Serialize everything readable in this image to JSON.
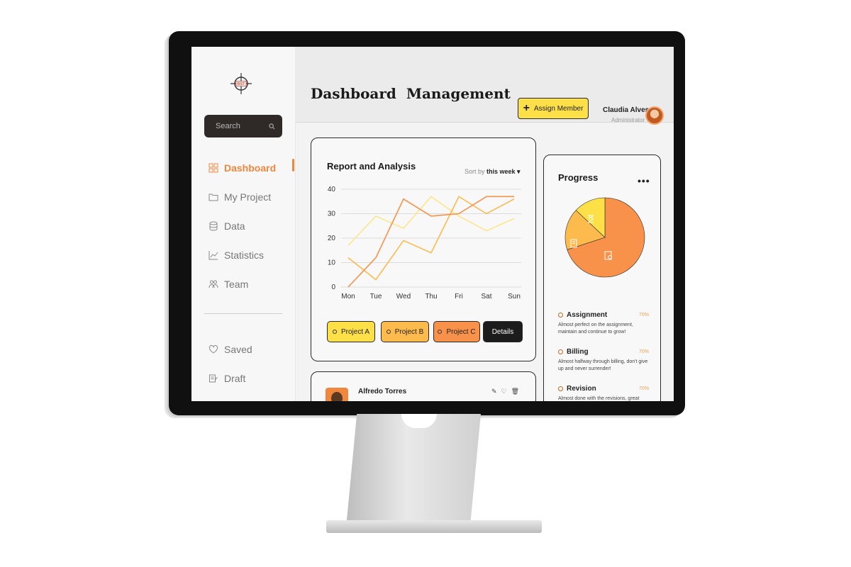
{
  "sidebar": {
    "logo_text": "RST",
    "search_placeholder": "Search",
    "items": [
      {
        "label": "Dashboard",
        "icon": "grid-icon",
        "active": true
      },
      {
        "label": "My Project",
        "icon": "folder-icon"
      },
      {
        "label": "Data",
        "icon": "database-icon"
      },
      {
        "label": "Statistics",
        "icon": "chart-icon"
      },
      {
        "label": "Team",
        "icon": "team-icon"
      }
    ],
    "secondary": [
      {
        "label": "Saved",
        "icon": "heart-icon"
      },
      {
        "label": "Draft",
        "icon": "draft-icon"
      }
    ]
  },
  "header": {
    "title": "Dashboard  Management",
    "assign_label": "Assign Member",
    "user_name": "Claudia Alves",
    "user_role": "Administrator"
  },
  "report": {
    "title": "Report and Analysis",
    "sort_label": "Sort by",
    "sort_value": "this week ▾",
    "buttons": [
      {
        "label": "Project A",
        "color": "#fde047"
      },
      {
        "label": "Project B",
        "color": "#fdba4d"
      },
      {
        "label": "Project C",
        "color": "#f8914a"
      }
    ],
    "details_label": "Details"
  },
  "chart_data": {
    "type": "line",
    "categories": [
      "Mon",
      "Tue",
      "Wed",
      "Thu",
      "Fri",
      "Sat",
      "Sun"
    ],
    "ylim": [
      0,
      40
    ],
    "yticks": [
      0,
      10,
      20,
      30,
      40
    ],
    "grid": true,
    "series": [
      {
        "color": "#fde68a",
        "values": [
          17,
          29,
          24,
          37,
          29,
          23,
          28
        ]
      },
      {
        "color": "#fdba4d",
        "values": [
          12,
          3,
          19,
          14,
          37,
          30,
          36
        ]
      },
      {
        "color": "#f8914a",
        "values": [
          0,
          12,
          36,
          29,
          30,
          37,
          37
        ]
      }
    ],
    "title": "",
    "xlabel": "",
    "ylabel": ""
  },
  "progress": {
    "title": "Progress",
    "pie": [
      {
        "value": 70,
        "color": "#f8914a"
      },
      {
        "value": 17,
        "color": "#fdba4d"
      },
      {
        "value": 13,
        "color": "#fde047"
      }
    ],
    "items": [
      {
        "name": "Assignment",
        "pct": "70%",
        "desc": "Almost perfect on the assignment, maintain and continue to grow!"
      },
      {
        "name": "Billing",
        "pct": "70%",
        "desc": "Almost halfway through billing, don't give up and never surrender!"
      },
      {
        "name": "Revision",
        "pct": "70%",
        "desc": "Almost done with the revisions, great"
      }
    ]
  },
  "member": {
    "name": "Alfredo Torres"
  }
}
